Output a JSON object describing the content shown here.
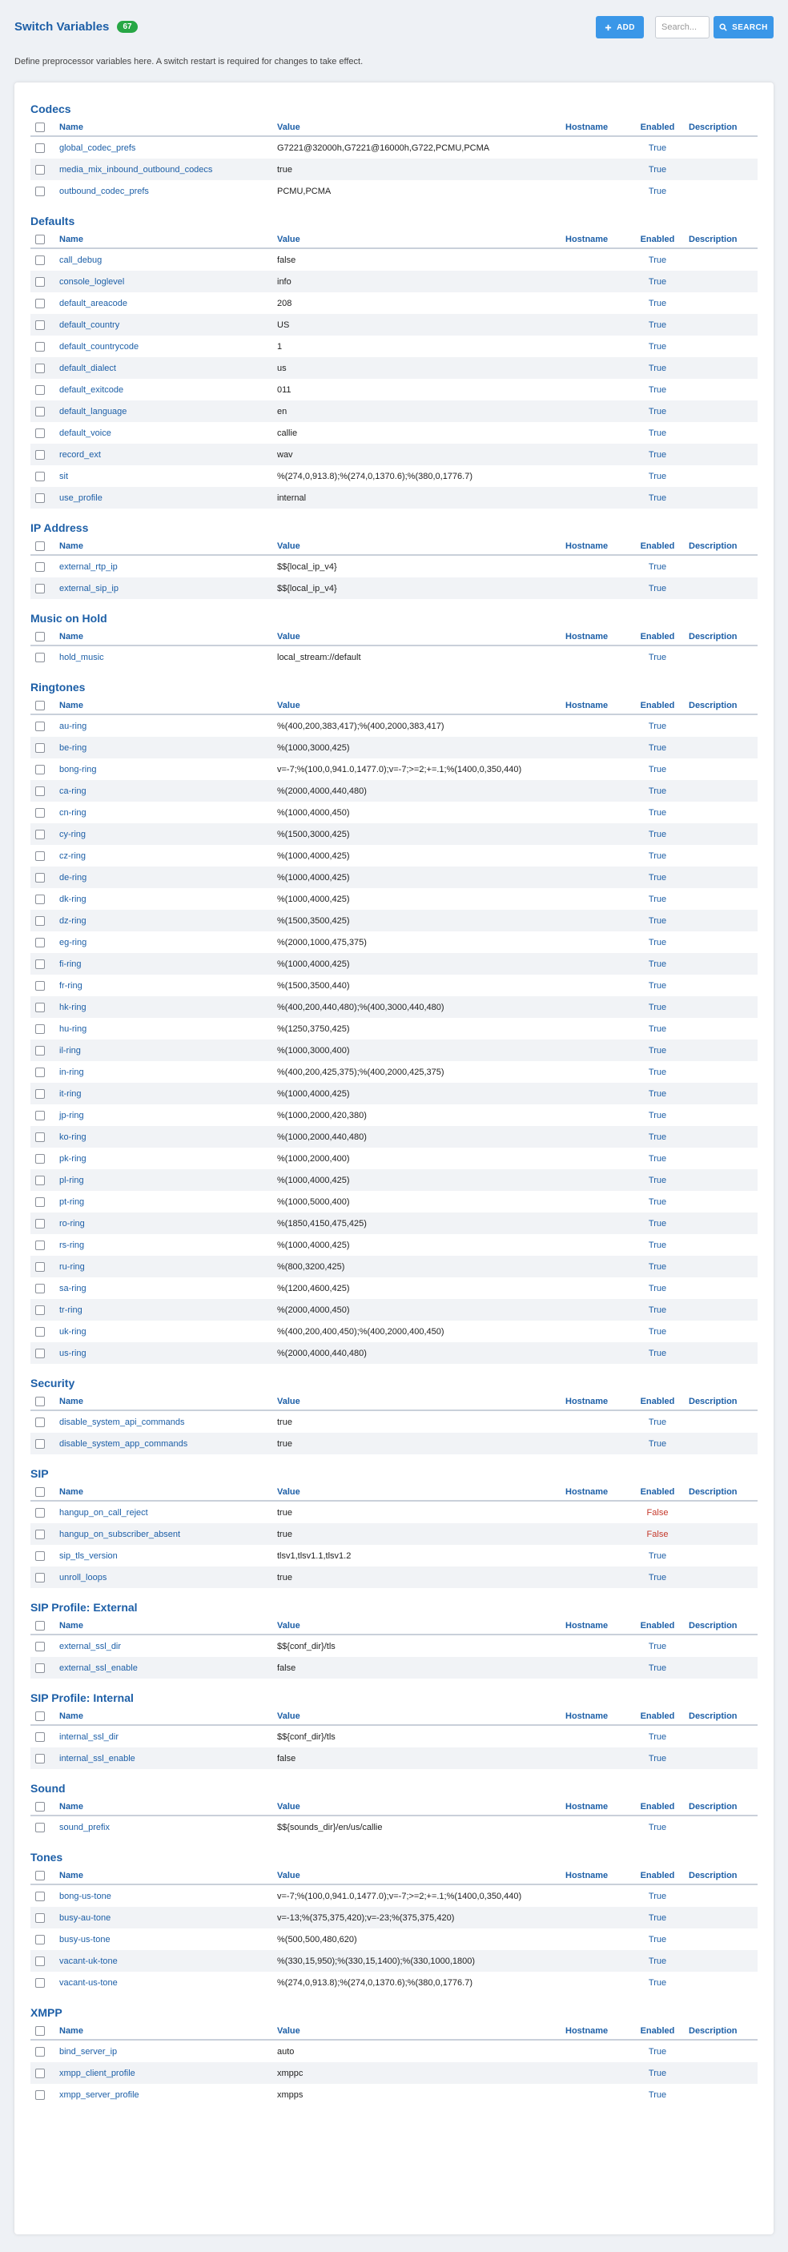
{
  "header": {
    "title": "Switch Variables",
    "count": "67",
    "add_label": "ADD",
    "search_placeholder": "Search...",
    "search_label": "SEARCH"
  },
  "description": "Define preprocessor variables here. A switch restart is required for changes to take effect.",
  "columns": {
    "name": "Name",
    "value": "Value",
    "hostname": "Hostname",
    "enabled": "Enabled",
    "description": "Description"
  },
  "sections": [
    {
      "title": "Codecs",
      "rows": [
        {
          "name": "global_codec_prefs",
          "value": "G7221@32000h,G7221@16000h,G722,PCMU,PCMA",
          "enabled": "True"
        },
        {
          "name": "media_mix_inbound_outbound_codecs",
          "value": "true",
          "enabled": "True"
        },
        {
          "name": "outbound_codec_prefs",
          "value": "PCMU,PCMA",
          "enabled": "True"
        }
      ]
    },
    {
      "title": "Defaults",
      "rows": [
        {
          "name": "call_debug",
          "value": "false",
          "enabled": "True"
        },
        {
          "name": "console_loglevel",
          "value": "info",
          "enabled": "True"
        },
        {
          "name": "default_areacode",
          "value": "208",
          "enabled": "True"
        },
        {
          "name": "default_country",
          "value": "US",
          "enabled": "True"
        },
        {
          "name": "default_countrycode",
          "value": "1",
          "enabled": "True"
        },
        {
          "name": "default_dialect",
          "value": "us",
          "enabled": "True"
        },
        {
          "name": "default_exitcode",
          "value": "011",
          "enabled": "True"
        },
        {
          "name": "default_language",
          "value": "en",
          "enabled": "True"
        },
        {
          "name": "default_voice",
          "value": "callie",
          "enabled": "True"
        },
        {
          "name": "record_ext",
          "value": "wav",
          "enabled": "True"
        },
        {
          "name": "sit",
          "value": "%(274,0,913.8);%(274,0,1370.6);%(380,0,1776.7)",
          "enabled": "True"
        },
        {
          "name": "use_profile",
          "value": "internal",
          "enabled": "True"
        }
      ]
    },
    {
      "title": "IP Address",
      "rows": [
        {
          "name": "external_rtp_ip",
          "value": "$${local_ip_v4}",
          "enabled": "True"
        },
        {
          "name": "external_sip_ip",
          "value": "$${local_ip_v4}",
          "enabled": "True"
        }
      ]
    },
    {
      "title": "Music on Hold",
      "rows": [
        {
          "name": "hold_music",
          "value": "local_stream://default",
          "enabled": "True"
        }
      ]
    },
    {
      "title": "Ringtones",
      "rows": [
        {
          "name": "au-ring",
          "value": "%(400,200,383,417);%(400,2000,383,417)",
          "enabled": "True"
        },
        {
          "name": "be-ring",
          "value": "%(1000,3000,425)",
          "enabled": "True"
        },
        {
          "name": "bong-ring",
          "value": "v=-7;%(100,0,941.0,1477.0);v=-7;>=2;+=.1;%(1400,0,350,440)",
          "enabled": "True"
        },
        {
          "name": "ca-ring",
          "value": "%(2000,4000,440,480)",
          "enabled": "True"
        },
        {
          "name": "cn-ring",
          "value": "%(1000,4000,450)",
          "enabled": "True"
        },
        {
          "name": "cy-ring",
          "value": "%(1500,3000,425)",
          "enabled": "True"
        },
        {
          "name": "cz-ring",
          "value": "%(1000,4000,425)",
          "enabled": "True"
        },
        {
          "name": "de-ring",
          "value": "%(1000,4000,425)",
          "enabled": "True"
        },
        {
          "name": "dk-ring",
          "value": "%(1000,4000,425)",
          "enabled": "True"
        },
        {
          "name": "dz-ring",
          "value": "%(1500,3500,425)",
          "enabled": "True"
        },
        {
          "name": "eg-ring",
          "value": "%(2000,1000,475,375)",
          "enabled": "True"
        },
        {
          "name": "fi-ring",
          "value": "%(1000,4000,425)",
          "enabled": "True"
        },
        {
          "name": "fr-ring",
          "value": "%(1500,3500,440)",
          "enabled": "True"
        },
        {
          "name": "hk-ring",
          "value": "%(400,200,440,480);%(400,3000,440,480)",
          "enabled": "True"
        },
        {
          "name": "hu-ring",
          "value": "%(1250,3750,425)",
          "enabled": "True"
        },
        {
          "name": "il-ring",
          "value": "%(1000,3000,400)",
          "enabled": "True"
        },
        {
          "name": "in-ring",
          "value": "%(400,200,425,375);%(400,2000,425,375)",
          "enabled": "True"
        },
        {
          "name": "it-ring",
          "value": "%(1000,4000,425)",
          "enabled": "True"
        },
        {
          "name": "jp-ring",
          "value": "%(1000,2000,420,380)",
          "enabled": "True"
        },
        {
          "name": "ko-ring",
          "value": "%(1000,2000,440,480)",
          "enabled": "True"
        },
        {
          "name": "pk-ring",
          "value": "%(1000,2000,400)",
          "enabled": "True"
        },
        {
          "name": "pl-ring",
          "value": "%(1000,4000,425)",
          "enabled": "True"
        },
        {
          "name": "pt-ring",
          "value": "%(1000,5000,400)",
          "enabled": "True"
        },
        {
          "name": "ro-ring",
          "value": "%(1850,4150,475,425)",
          "enabled": "True"
        },
        {
          "name": "rs-ring",
          "value": "%(1000,4000,425)",
          "enabled": "True"
        },
        {
          "name": "ru-ring",
          "value": "%(800,3200,425)",
          "enabled": "True"
        },
        {
          "name": "sa-ring",
          "value": "%(1200,4600,425)",
          "enabled": "True"
        },
        {
          "name": "tr-ring",
          "value": "%(2000,4000,450)",
          "enabled": "True"
        },
        {
          "name": "uk-ring",
          "value": "%(400,200,400,450);%(400,2000,400,450)",
          "enabled": "True"
        },
        {
          "name": "us-ring",
          "value": "%(2000,4000,440,480)",
          "enabled": "True"
        }
      ]
    },
    {
      "title": "Security",
      "rows": [
        {
          "name": "disable_system_api_commands",
          "value": "true",
          "enabled": "True"
        },
        {
          "name": "disable_system_app_commands",
          "value": "true",
          "enabled": "True"
        }
      ]
    },
    {
      "title": "SIP",
      "rows": [
        {
          "name": "hangup_on_call_reject",
          "value": "true",
          "enabled": "False"
        },
        {
          "name": "hangup_on_subscriber_absent",
          "value": "true",
          "enabled": "False"
        },
        {
          "name": "sip_tls_version",
          "value": "tlsv1,tlsv1.1,tlsv1.2",
          "enabled": "True"
        },
        {
          "name": "unroll_loops",
          "value": "true",
          "enabled": "True"
        }
      ]
    },
    {
      "title": "SIP Profile: External",
      "rows": [
        {
          "name": "external_ssl_dir",
          "value": "$${conf_dir}/tls",
          "enabled": "True"
        },
        {
          "name": "external_ssl_enable",
          "value": "false",
          "enabled": "True"
        }
      ]
    },
    {
      "title": "SIP Profile: Internal",
      "rows": [
        {
          "name": "internal_ssl_dir",
          "value": "$${conf_dir}/tls",
          "enabled": "True"
        },
        {
          "name": "internal_ssl_enable",
          "value": "false",
          "enabled": "True"
        }
      ]
    },
    {
      "title": "Sound",
      "rows": [
        {
          "name": "sound_prefix",
          "value": "$${sounds_dir}/en/us/callie",
          "enabled": "True"
        }
      ]
    },
    {
      "title": "Tones",
      "rows": [
        {
          "name": "bong-us-tone",
          "value": "v=-7;%(100,0,941.0,1477.0);v=-7;>=2;+=.1;%(1400,0,350,440)",
          "enabled": "True"
        },
        {
          "name": "busy-au-tone",
          "value": "v=-13;%(375,375,420);v=-23;%(375,375,420)",
          "enabled": "True"
        },
        {
          "name": "busy-us-tone",
          "value": "%(500,500,480,620)",
          "enabled": "True"
        },
        {
          "name": "vacant-uk-tone",
          "value": "%(330,15,950);%(330,15,1400);%(330,1000,1800)",
          "enabled": "True"
        },
        {
          "name": "vacant-us-tone",
          "value": "%(274,0,913.8);%(274,0,1370.6);%(380,0,1776.7)",
          "enabled": "True"
        }
      ]
    },
    {
      "title": "XMPP",
      "rows": [
        {
          "name": "bind_server_ip",
          "value": "auto",
          "enabled": "True"
        },
        {
          "name": "xmpp_client_profile",
          "value": "xmppc",
          "enabled": "True"
        },
        {
          "name": "xmpp_server_profile",
          "value": "xmpps",
          "enabled": "True"
        }
      ]
    }
  ]
}
